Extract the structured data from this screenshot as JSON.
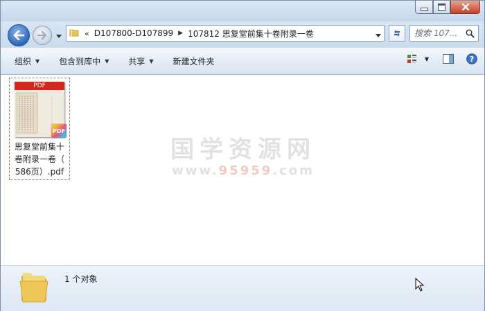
{
  "window": {
    "caption_buttons": [
      "minimize",
      "maximize",
      "close"
    ]
  },
  "navigation": {
    "breadcrumb": [
      {
        "label": "D107800-D107899"
      },
      {
        "label": "107812 思复堂前集十卷附录一卷"
      }
    ],
    "overflow_marker": "«",
    "search_placeholder": "搜索 107..."
  },
  "toolbar": {
    "organize": "组织",
    "include_library": "包含到库中",
    "share": "共享",
    "new_folder": "新建文件夹"
  },
  "files": [
    {
      "name": "思复堂前集十卷附录一卷（586页）.pdf",
      "name_lines": [
        "思复堂前集十",
        "卷附录一卷（",
        "586页）.pdf"
      ],
      "thumb_badge": "PDF",
      "type_badge": "PDF"
    }
  ],
  "watermark": {
    "title": "国学资源网",
    "url_prefix": "www.",
    "url_highlight": "95959",
    "url_suffix": ".com"
  },
  "status": {
    "text": "1 个对象"
  },
  "colors": {
    "pdf_red": "#d3261c",
    "window_frame": "#c7daed",
    "accent_blue": "#2d66b8"
  }
}
